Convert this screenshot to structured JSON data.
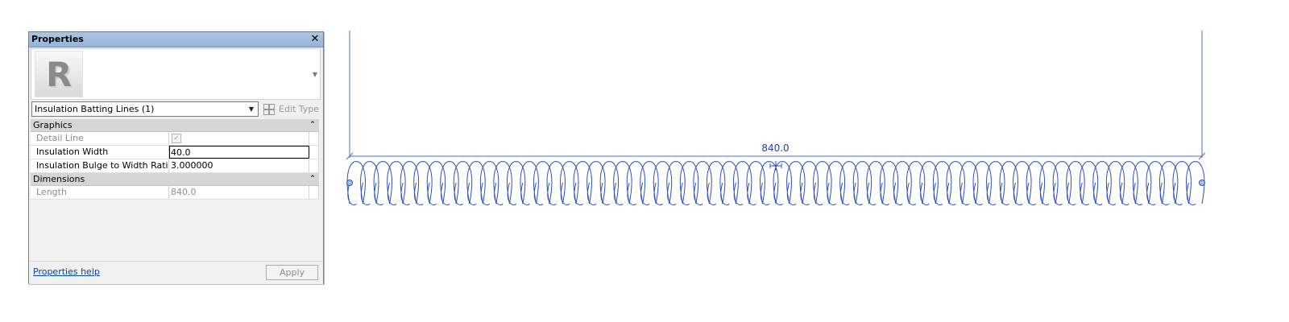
{
  "palette": {
    "title": "Properties",
    "close_glyph": "✕",
    "type_selector": {
      "value": "Insulation Batting Lines (1)"
    },
    "edit_type_label": "Edit Type",
    "groups": {
      "graphics": {
        "label": "Graphics"
      },
      "dimensions": {
        "label": "Dimensions"
      }
    },
    "properties": {
      "detail_line": {
        "label": "Detail Line",
        "checked": true
      },
      "insulation_width": {
        "label": "Insulation Width",
        "value": "40.0"
      },
      "bulge_ratio": {
        "label": "Insulation Bulge to Width Ratio (...",
        "value": "3.000000"
      },
      "length": {
        "label": "Length",
        "value": "840.0"
      }
    },
    "help_link": "Properties help",
    "apply_label": "Apply",
    "logo_letter": "R"
  },
  "canvas": {
    "dimension_value": "840.0",
    "line_color": "#1f3fb0",
    "batt_color": "#2d4fbf",
    "batt_loops": 64
  }
}
